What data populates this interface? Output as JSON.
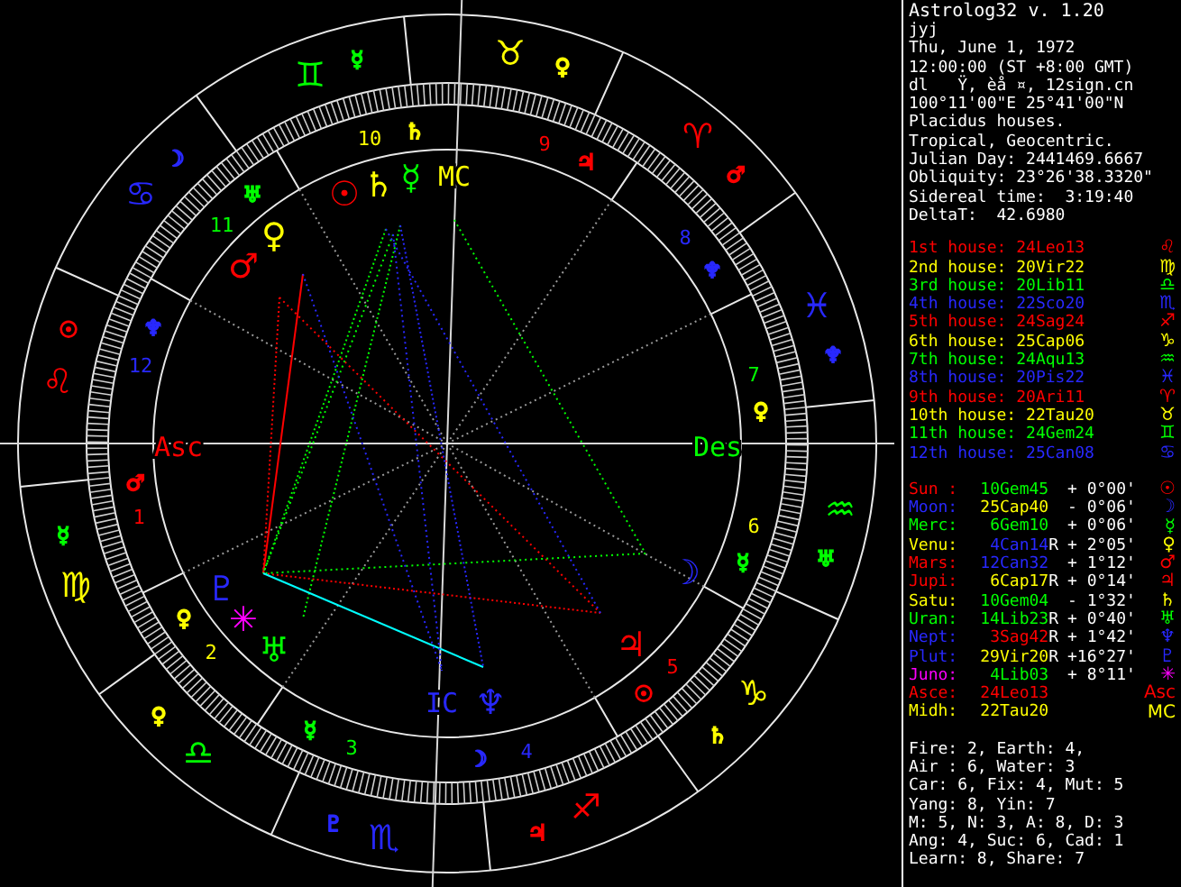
{
  "chart": {
    "signs": [
      {
        "glyph": "♈",
        "color": "#ff0000",
        "ruler": {
          "glyph": "♂",
          "color": "#ff0000"
        }
      },
      {
        "glyph": "♉",
        "color": "#ffff00",
        "ruler": {
          "glyph": "♀",
          "color": "#ffff00"
        }
      },
      {
        "glyph": "♊",
        "color": "#00ff00",
        "ruler": {
          "glyph": "☿",
          "color": "#00ff00"
        }
      },
      {
        "glyph": "♋",
        "color": "#2828ff",
        "ruler": {
          "glyph": "☽",
          "color": "#2828ff"
        }
      },
      {
        "glyph": "♌",
        "color": "#ff0000",
        "ruler": {
          "glyph": "☉",
          "color": "#ff0000"
        }
      },
      {
        "glyph": "♍",
        "color": "#ffff00",
        "ruler": {
          "glyph": "☿",
          "color": "#00ff00"
        }
      },
      {
        "glyph": "♎",
        "color": "#00ff00",
        "ruler": {
          "glyph": "♀",
          "color": "#ffff00"
        }
      },
      {
        "glyph": "♏",
        "color": "#2828ff",
        "ruler": {
          "glyph": "♇",
          "color": "#2828ff"
        }
      },
      {
        "glyph": "♐",
        "color": "#ff0000",
        "ruler": {
          "glyph": "♃",
          "color": "#ff0000"
        }
      },
      {
        "glyph": "♑",
        "color": "#ffff00",
        "ruler": {
          "glyph": "♄",
          "color": "#ffff00"
        }
      },
      {
        "glyph": "♒",
        "color": "#00ff00",
        "ruler": {
          "glyph": "♅",
          "color": "#00ff00"
        }
      },
      {
        "glyph": "♓",
        "color": "#2828ff",
        "ruler": {
          "glyph": "♆",
          "color": "#2828ff"
        }
      }
    ],
    "houses": [
      {
        "number": "1",
        "color": "#ff0000",
        "ruler": {
          "glyph": "♂",
          "color": "#ff0000"
        }
      },
      {
        "number": "2",
        "color": "#ffff00",
        "ruler": {
          "glyph": "♀",
          "color": "#ffff00"
        }
      },
      {
        "number": "3",
        "color": "#00ff00",
        "ruler": {
          "glyph": "☿",
          "color": "#00ff00"
        }
      },
      {
        "number": "4",
        "color": "#2828ff",
        "ruler": {
          "glyph": "☽",
          "color": "#2828ff"
        }
      },
      {
        "number": "5",
        "color": "#ff0000",
        "ruler": {
          "glyph": "☉",
          "color": "#ff0000"
        }
      },
      {
        "number": "6",
        "color": "#ffff00",
        "ruler": {
          "glyph": "☿",
          "color": "#00ff00"
        }
      },
      {
        "number": "7",
        "color": "#00ff00",
        "ruler": {
          "glyph": "♀",
          "color": "#ffff00"
        }
      },
      {
        "number": "8",
        "color": "#2828ff",
        "ruler": {
          "glyph": "♆",
          "color": "#2828ff"
        }
      },
      {
        "number": "9",
        "color": "#ff0000",
        "ruler": {
          "glyph": "♃",
          "color": "#ff0000"
        }
      },
      {
        "number": "10",
        "color": "#ffff00",
        "ruler": {
          "glyph": "♄",
          "color": "#ffff00"
        }
      },
      {
        "number": "11",
        "color": "#00ff00",
        "ruler": {
          "glyph": "♅",
          "color": "#00ff00"
        }
      },
      {
        "number": "12",
        "color": "#2828ff",
        "ruler": {
          "glyph": "♆",
          "color": "#2828ff"
        }
      }
    ],
    "angles": [
      {
        "label": "Asc",
        "color": "#ff0000"
      },
      {
        "label": "MC",
        "color": "#ffff00"
      },
      {
        "label": "Des",
        "color": "#00ff00"
      },
      {
        "label": "IC",
        "color": "#2828ff"
      }
    ],
    "planets": [
      {
        "glyph": "☉",
        "color": "#ff0000"
      },
      {
        "glyph": "♄",
        "color": "#ffff00"
      },
      {
        "glyph": "☿",
        "color": "#00ff00"
      },
      {
        "glyph": "♀",
        "color": "#ffff00"
      },
      {
        "glyph": "♂",
        "color": "#ff0000"
      },
      {
        "glyph": "♇",
        "color": "#2828ff"
      },
      {
        "glyph": "✳",
        "color": "#ff00ff"
      },
      {
        "glyph": "♅",
        "color": "#00ff00"
      },
      {
        "glyph": "♆",
        "color": "#2828ff"
      },
      {
        "glyph": "♃",
        "color": "#ff0000"
      },
      {
        "glyph": "☽",
        "color": "#2828ff"
      }
    ]
  },
  "info": [
    "Astrolog32 v. 1.20",
    "jyj",
    "Thu, June 1, 1972",
    "12:00:00 (ST +8:00 GMT)",
    "dl   Ÿ, èå ¤, 12sign.cn",
    "100°11'00\"E 25°41'00\"N",
    "Placidus houses.",
    "Tropical, Geocentric.",
    "Julian Day: 2441469.6667",
    "Obliquity: 23°26'38.3320\"",
    "Sidereal time:  3:19:40",
    "DeltaT:  42.6980"
  ],
  "house_list": [
    {
      "text": "1st house: 24Leo13",
      "color": "#ff0000",
      "sign": {
        "glyph": "♌",
        "color": "#ff0000"
      }
    },
    {
      "text": "2nd house: 20Vir22",
      "color": "#ffff00",
      "sign": {
        "glyph": "♍",
        "color": "#ffff00"
      }
    },
    {
      "text": "3rd house: 20Lib11",
      "color": "#00ff00",
      "sign": {
        "glyph": "♎",
        "color": "#00ff00"
      }
    },
    {
      "text": "4th house: 22Sco20",
      "color": "#2828ff",
      "sign": {
        "glyph": "♏",
        "color": "#2828ff"
      }
    },
    {
      "text": "5th house: 24Sag24",
      "color": "#ff0000",
      "sign": {
        "glyph": "♐",
        "color": "#ff0000"
      }
    },
    {
      "text": "6th house: 25Cap06",
      "color": "#ffff00",
      "sign": {
        "glyph": "♑",
        "color": "#ffff00"
      }
    },
    {
      "text": "7th house: 24Aqu13",
      "color": "#00ff00",
      "sign": {
        "glyph": "♒",
        "color": "#00ff00"
      }
    },
    {
      "text": "8th house: 20Pis22",
      "color": "#2828ff",
      "sign": {
        "glyph": "♓",
        "color": "#2828ff"
      }
    },
    {
      "text": "9th house: 20Ari11",
      "color": "#ff0000",
      "sign": {
        "glyph": "♈",
        "color": "#ff0000"
      }
    },
    {
      "text": "10th house: 22Tau20",
      "color": "#ffff00",
      "sign": {
        "glyph": "♉",
        "color": "#ffff00"
      }
    },
    {
      "text": "11th house: 24Gem24",
      "color": "#00ff00",
      "sign": {
        "glyph": "♊",
        "color": "#00ff00"
      }
    },
    {
      "text": "12th house: 25Can08",
      "color": "#2828ff",
      "sign": {
        "glyph": "♋",
        "color": "#2828ff"
      }
    }
  ],
  "planet_list": [
    {
      "name": "Sun :",
      "color": "#ff0000",
      "position": {
        "text": "10Gem45",
        "color": "#00ff00"
      },
      "motion": "+ 0°00'",
      "glyph": "☉"
    },
    {
      "name": "Moon:",
      "color": "#2828ff",
      "position": {
        "text": "25Cap40",
        "color": "#ffff00"
      },
      "motion": "- 0°06'",
      "glyph": "☽"
    },
    {
      "name": "Merc:",
      "color": "#00ff00",
      "position": {
        "text": "6Gem10",
        "color": "#00ff00"
      },
      "motion": "+ 0°06'",
      "glyph": "☿"
    },
    {
      "name": "Venu:",
      "color": "#ffff00",
      "position": {
        "text": "4Can14",
        "color": "#2828ff"
      },
      "retro": "R",
      "motion": "+ 2°05'",
      "glyph": "♀"
    },
    {
      "name": "Mars:",
      "color": "#ff0000",
      "position": {
        "text": "12Can32",
        "color": "#2828ff"
      },
      "motion": "+ 1°12'",
      "glyph": "♂"
    },
    {
      "name": "Jupi:",
      "color": "#ff0000",
      "position": {
        "text": "6Cap17",
        "color": "#ffff00"
      },
      "retro": "R",
      "motion": "+ 0°14'",
      "glyph": "♃"
    },
    {
      "name": "Satu:",
      "color": "#ffff00",
      "position": {
        "text": "10Gem04",
        "color": "#00ff00"
      },
      "motion": "- 1°32'",
      "glyph": "♄"
    },
    {
      "name": "Uran:",
      "color": "#00ff00",
      "position": {
        "text": "14Lib23",
        "color": "#00ff00"
      },
      "retro": "R",
      "motion": "+ 0°40'",
      "glyph": "♅"
    },
    {
      "name": "Nept:",
      "color": "#2828ff",
      "position": {
        "text": "3Sag42",
        "color": "#ff0000"
      },
      "retro": "R",
      "motion": "+ 1°42'",
      "glyph": "♆"
    },
    {
      "name": "Plut:",
      "color": "#2828ff",
      "position": {
        "text": "29Vir20",
        "color": "#ffff00"
      },
      "retro": "R",
      "motion": "+16°27'",
      "glyph": "♇"
    },
    {
      "name": "Juno:",
      "color": "#ff00ff",
      "position": {
        "text": "4Lib03",
        "color": "#00ff00"
      },
      "motion": "+ 8°11'",
      "glyph": "✳"
    },
    {
      "name": "Asce:",
      "color": "#ff0000",
      "position": {
        "text": "24Leo13",
        "color": "#ff0000"
      },
      "glyph": "Asc"
    },
    {
      "name": "Midh:",
      "color": "#ffff00",
      "position": {
        "text": "22Tau20",
        "color": "#ffff00"
      },
      "glyph": "MC"
    }
  ],
  "summary": [
    "Fire: 2, Earth: 4,",
    "Air : 6, Water: 3",
    "Car: 6, Fix: 4, Mut: 5",
    "Yang: 8, Yin: 7",
    "M: 5, N: 3, A: 8, D: 3",
    "Ang: 4, Suc: 6, Cad: 1",
    "Learn: 8, Share: 7"
  ]
}
